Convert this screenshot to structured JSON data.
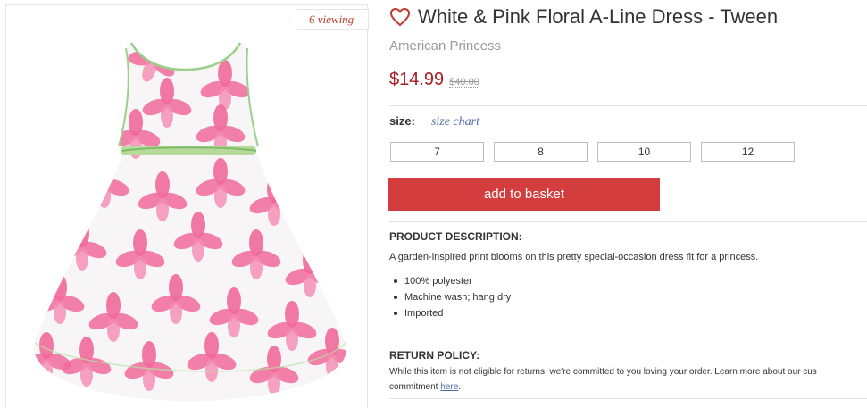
{
  "product": {
    "viewing": "6 viewing",
    "title": "White & Pink Floral A-Line Dress - Tween",
    "brand": "American Princess",
    "price": "$14.99",
    "original_price": "$40.00"
  },
  "size": {
    "label": "size:",
    "chart_link": "size chart",
    "options": [
      "7",
      "8",
      "10",
      "12"
    ]
  },
  "actions": {
    "add_to_basket": "add to basket"
  },
  "description": {
    "heading": "PRODUCT DESCRIPTION:",
    "text": "A garden-inspired print blooms on this pretty special-occasion dress fit for a princess.",
    "bullets": [
      "100% polyester",
      "Machine wash; hang dry",
      "Imported"
    ]
  },
  "returns": {
    "heading": "RETURN POLICY:",
    "line1": "While this item is not eligible for returns, we're committed to you loving your order. Learn more about our cus",
    "line2_prefix": "commitment ",
    "link": "here",
    "line2_suffix": "."
  },
  "colors": {
    "price_red": "#a71c22",
    "button_red": "#d43d3d",
    "link_blue": "#4b6ea9",
    "dress_pink": "#f06a9a"
  },
  "icons": {
    "favorite": "heart-outline-icon"
  }
}
